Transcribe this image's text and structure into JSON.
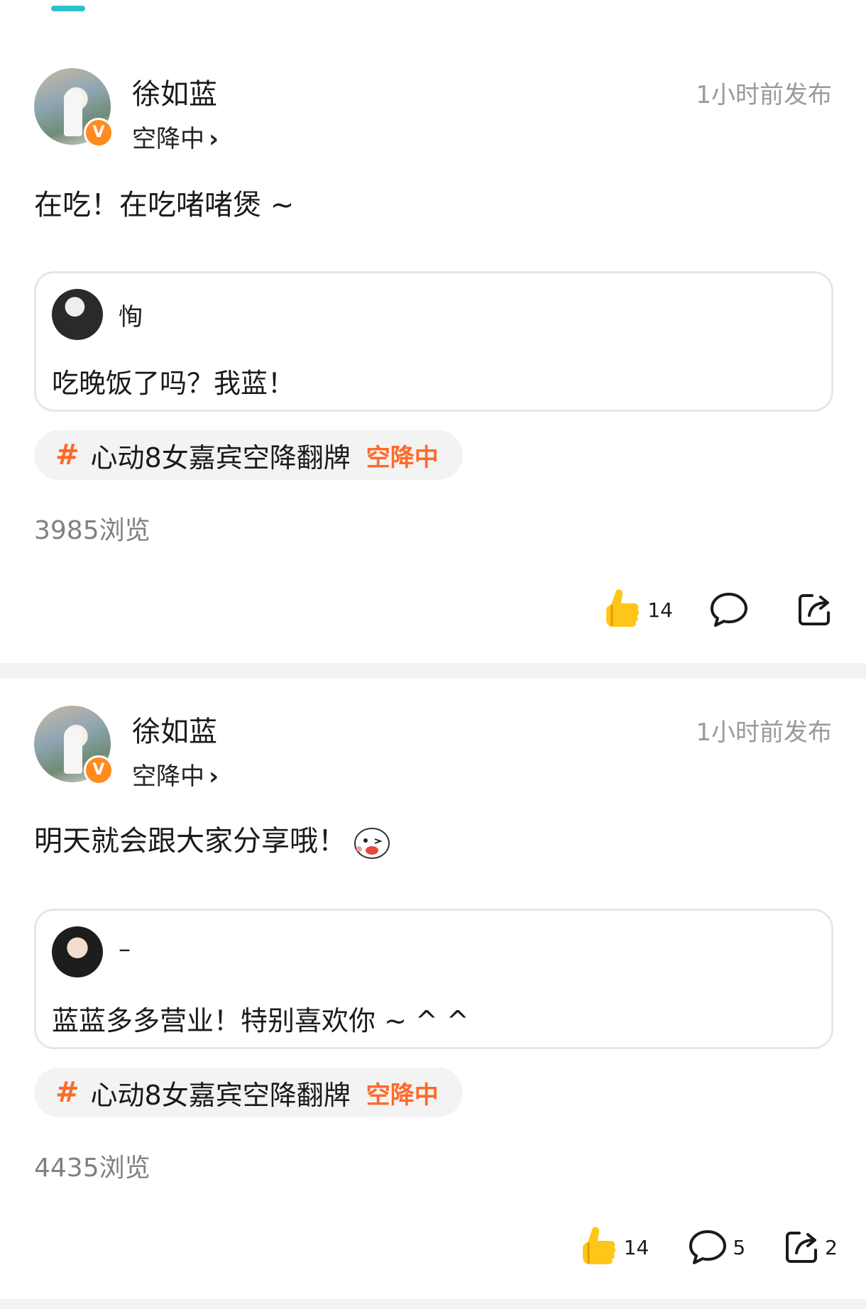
{
  "posts": [
    {
      "author": "徐如蓝",
      "status_text": "空降中",
      "time": "1小时前发布",
      "content": "在吃！在吃啫啫煲 ~",
      "quote": {
        "name": "恂",
        "text": "吃晚饭了吗？我蓝！"
      },
      "topic": {
        "name": "心动8女嘉宾空降翻牌",
        "tag": "空降中"
      },
      "views": "3985浏览",
      "likes": "14",
      "comments": "",
      "shares": ""
    },
    {
      "author": "徐如蓝",
      "status_text": "空降中",
      "time": "1小时前发布",
      "content": "明天就会跟大家分享哦！",
      "quote": {
        "name": "–",
        "text": "蓝蓝多多营业！特别喜欢你 ~ ^ ^"
      },
      "topic": {
        "name": "心动8女嘉宾空降翻牌",
        "tag": "空降中"
      },
      "views": "4435浏览",
      "likes": "14",
      "comments": "5",
      "shares": "2"
    }
  ],
  "icons": {
    "like": "thumbs-up-icon",
    "comment": "comment-bubble-icon",
    "share": "share-icon",
    "verified": "verified-v-icon",
    "hash": "hashtag-icon"
  },
  "colors": {
    "accent": "#ff6a2a",
    "badge": "#ff8a1f",
    "tab_indicator": "#2cc0c9",
    "muted_text": "#9a9a9a"
  },
  "verified_mark": "V",
  "hash_symbol": "#",
  "status_chevron": "›"
}
